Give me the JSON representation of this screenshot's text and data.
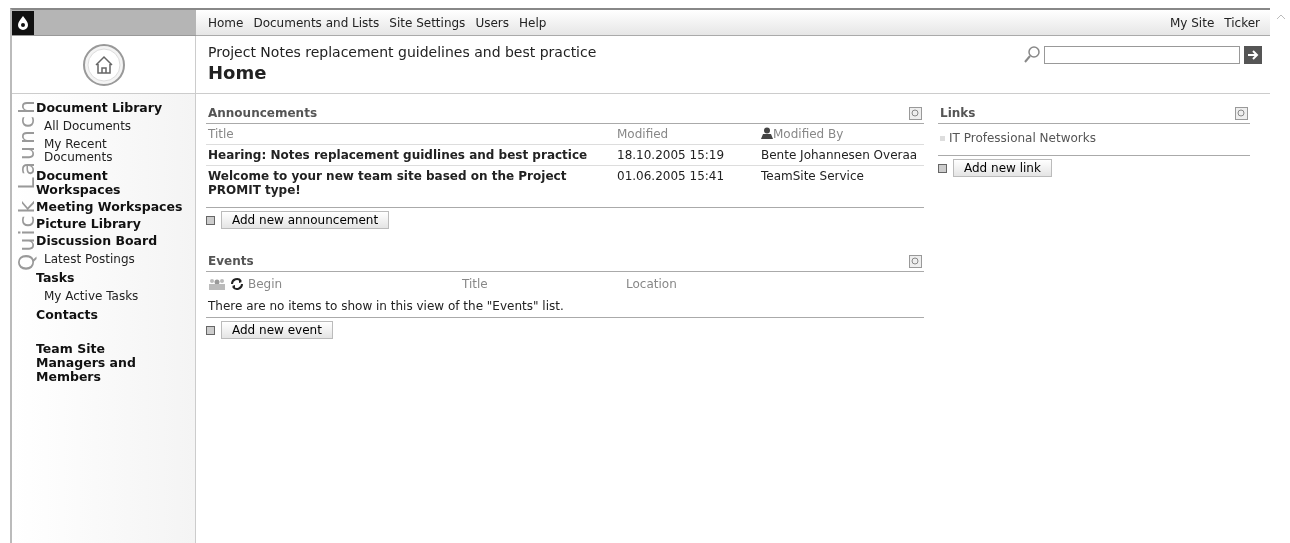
{
  "top_nav": {
    "items": [
      "Home",
      "Documents and Lists",
      "Site Settings",
      "Users",
      "Help"
    ],
    "right_items": [
      "My Site",
      "Ticker"
    ]
  },
  "header": {
    "site_title": "Project Notes replacement guidelines and best practice",
    "page_title": "Home"
  },
  "quick_launch": {
    "label": "Quick Launch",
    "items": [
      {
        "label": "Document Library",
        "children": [
          {
            "label": "All Documents"
          },
          {
            "label": "My Recent Documents"
          }
        ]
      },
      {
        "label": "Document Workspaces"
      },
      {
        "label": "Meeting Workspaces"
      },
      {
        "label": "Picture Library"
      },
      {
        "label": "Discussion Board",
        "children": [
          {
            "label": "Latest Postings"
          }
        ]
      },
      {
        "label": "Tasks",
        "children": [
          {
            "label": "My Active Tasks"
          }
        ]
      },
      {
        "label": "Contacts"
      },
      {
        "label": "Team Site Managers and Members"
      }
    ]
  },
  "announcements": {
    "title": "Announcements",
    "columns": [
      "Title",
      "Modified",
      "Modified By"
    ],
    "rows": [
      {
        "title": "Hearing: Notes replacement guidlines and best practice",
        "modified": "18.10.2005 15:19",
        "modified_by": "Bente Johannesen Overaa"
      },
      {
        "title": "Welcome to your new team site based on the Project PROMIT type!",
        "modified": "01.06.2005 15:41",
        "modified_by": "TeamSite Service"
      }
    ],
    "add_button": "Add new announcement"
  },
  "events": {
    "title": "Events",
    "columns": [
      "Begin",
      "Title",
      "Location"
    ],
    "empty_text": "There are no items to show in this view of the \"Events\" list.",
    "add_button": "Add new event"
  },
  "links": {
    "title": "Links",
    "items": [
      "IT Professional Networks"
    ],
    "add_button": "Add new link"
  }
}
